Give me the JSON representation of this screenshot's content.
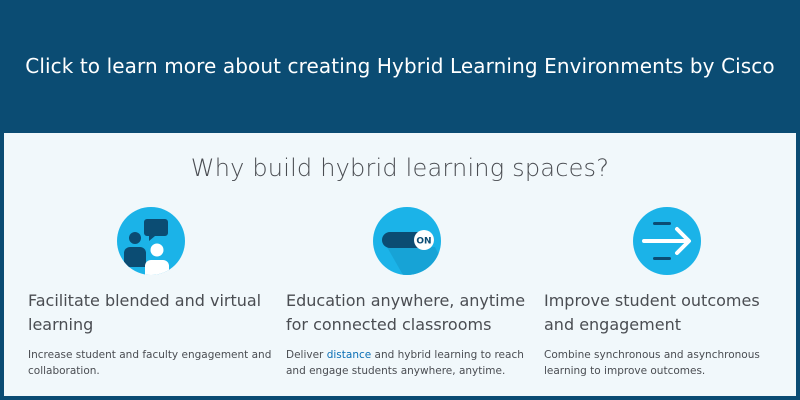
{
  "banner": {
    "text": "Click to learn more about creating Hybrid Learning Environments by Cisco"
  },
  "section": {
    "heading": "Why build hybrid learning spaces?"
  },
  "features": [
    {
      "icon": "people-chat-icon",
      "title": "Facilitate blended and virtual learning",
      "description": "Increase student and faculty engagement and collaboration."
    },
    {
      "icon": "on-toggle-icon",
      "icon_label": "ON",
      "title": "Education anywhere, anytime for connected classrooms",
      "description_before": "Deliver ",
      "description_link": "distance",
      "description_after": " and hybrid learning to reach and engage students anywhere, anytime."
    },
    {
      "icon": "arrow-right-icon",
      "title": "Improve student outcomes and engagement",
      "description": "Combine synchronous and asynchronous learning to improve outcomes."
    }
  ],
  "colors": {
    "banner": "#0b4c73",
    "panel": "#f1f8fb",
    "icon_circle": "#1bb3e8",
    "icon_dark": "#0b4c73",
    "link": "#0a6fb5",
    "text": "#4a4d52"
  }
}
